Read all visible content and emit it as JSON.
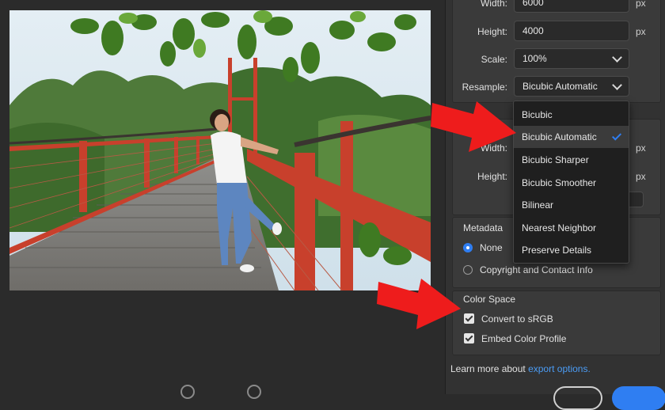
{
  "image_size": {
    "width_label": "Width:",
    "width_value": "6000",
    "height_label": "Height:",
    "height_value": "4000",
    "unit": "px"
  },
  "scale": {
    "label": "Scale:",
    "value": "100%"
  },
  "resample": {
    "label": "Resample:",
    "value": "Bicubic Automatic",
    "options": [
      "Bicubic",
      "Bicubic Automatic",
      "Bicubic Sharper",
      "Bicubic Smoother",
      "Bilinear",
      "Nearest Neighbor",
      "Preserve Details"
    ],
    "selected_index": 1
  },
  "canvas_size": {
    "width_label": "Width:",
    "height_label": "Height:",
    "unit": "px"
  },
  "metadata": {
    "title": "Metadata",
    "options": [
      {
        "label": "None",
        "selected": true
      },
      {
        "label": "Copyright and Contact Info",
        "selected": false
      }
    ]
  },
  "color_space": {
    "title": "Color Space",
    "options": [
      {
        "label": "Convert to sRGB",
        "checked": true
      },
      {
        "label": "Embed Color Profile",
        "checked": true
      }
    ]
  },
  "footer": {
    "learn_more": "Learn more about",
    "link": "export options."
  },
  "colors": {
    "accent": "#2f7ef2",
    "link": "#4b9cf5",
    "arrow": "#ee1c1c",
    "railing": "#c8402c"
  }
}
